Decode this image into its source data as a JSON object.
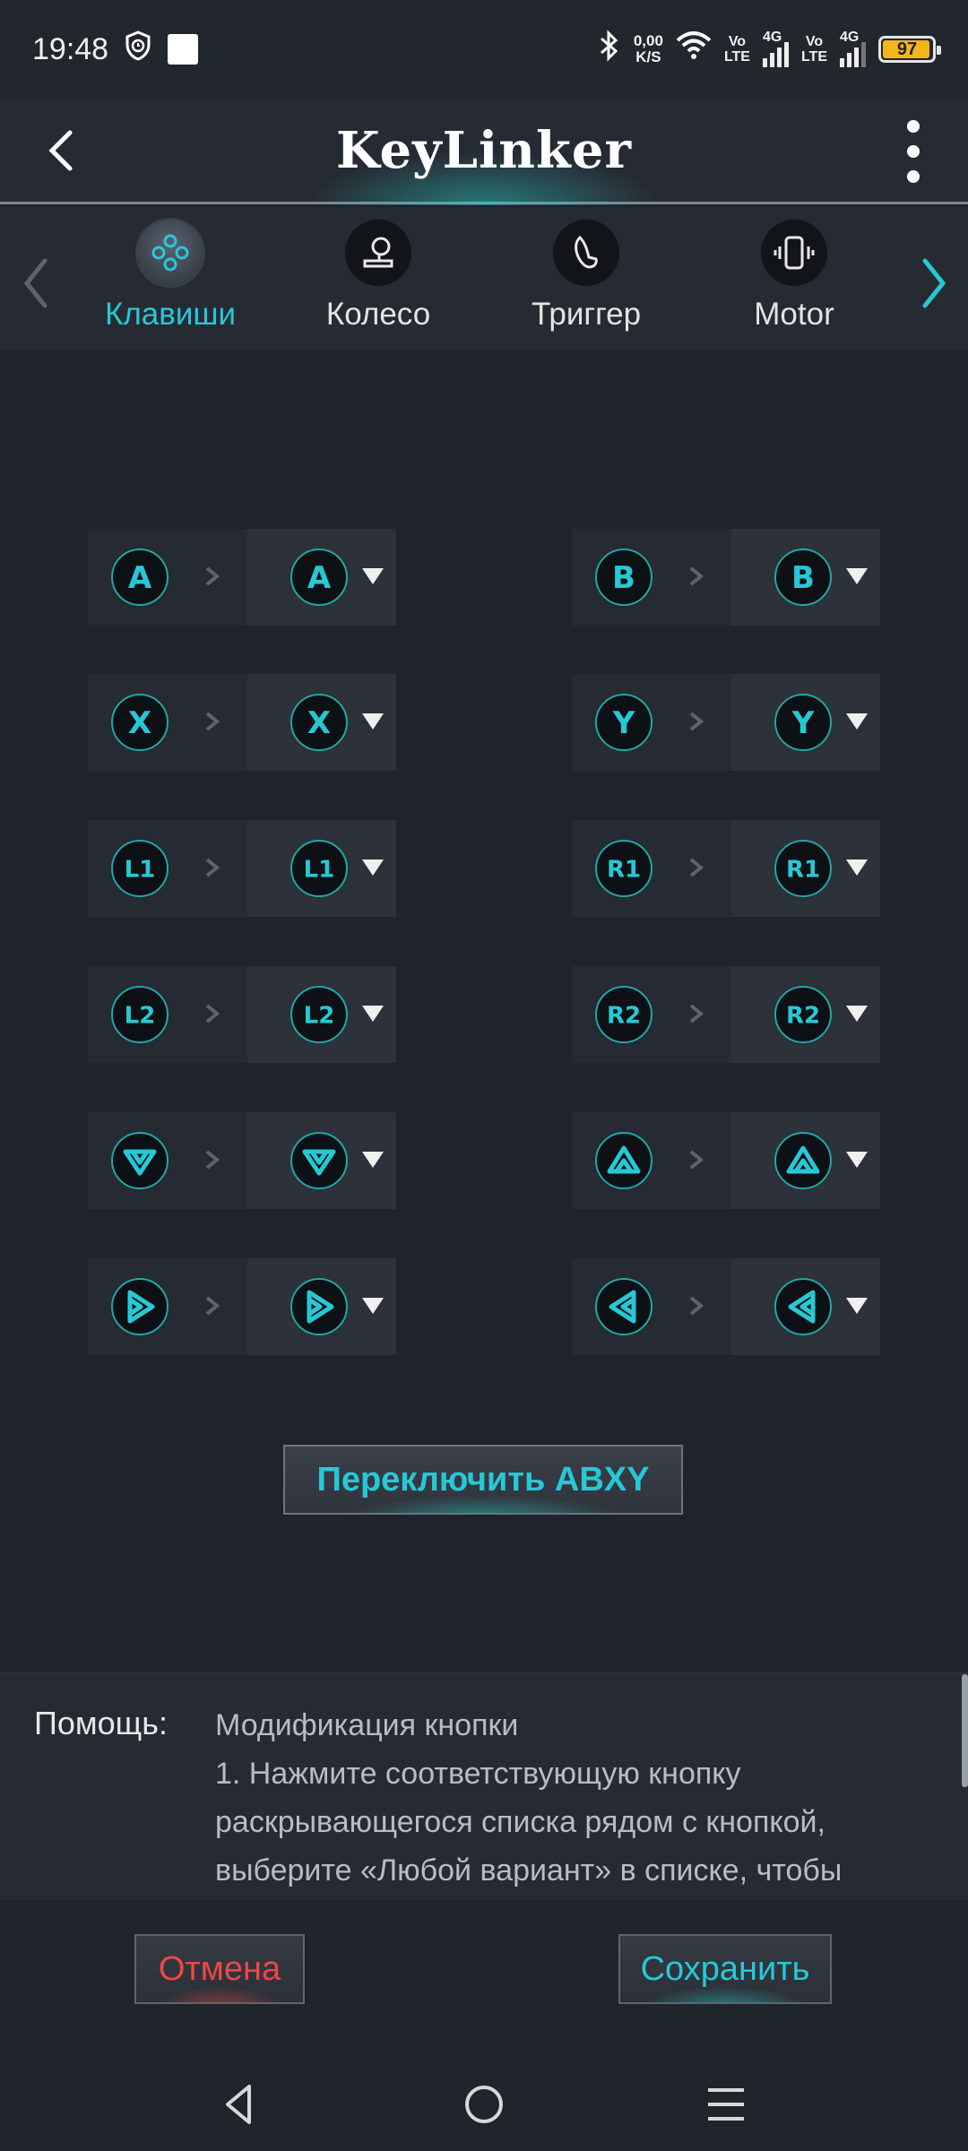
{
  "status_bar": {
    "time": "19:48",
    "net_speed_value": "0,00",
    "net_speed_unit": "K/S",
    "volte1_top": "Vo",
    "volte1_bottom": "LTE",
    "volte2_top": "Vo",
    "volte2_bottom": "LTE",
    "signal1_label": "4G",
    "signal2_label": "4G",
    "battery": "97",
    "icons": [
      "shield-clock-icon",
      "notification-square-icon",
      "bluetooth-icon",
      "wifi-icon",
      "signal-icon",
      "battery-icon"
    ]
  },
  "header": {
    "title": "KeyLinker"
  },
  "tabs": [
    {
      "label": "Клавиши",
      "icon": "gamepad-buttons-icon",
      "active": true
    },
    {
      "label": "Колесо",
      "icon": "joystick-icon",
      "active": false
    },
    {
      "label": "Триггер",
      "icon": "trigger-icon",
      "active": false
    },
    {
      "label": "Motor",
      "icon": "vibration-icon",
      "active": false
    }
  ],
  "mappings": [
    {
      "source": "A",
      "target": "A"
    },
    {
      "source": "B",
      "target": "B"
    },
    {
      "source": "X",
      "target": "X"
    },
    {
      "source": "Y",
      "target": "Y"
    },
    {
      "source": "L1",
      "target": "L1"
    },
    {
      "source": "R1",
      "target": "R1"
    },
    {
      "source": "L2",
      "target": "L2"
    },
    {
      "source": "R2",
      "target": "R2"
    },
    {
      "source": "dpad-down",
      "target": "dpad-down"
    },
    {
      "source": "dpad-up",
      "target": "dpad-up"
    },
    {
      "source": "dpad-right",
      "target": "dpad-right"
    },
    {
      "source": "dpad-left",
      "target": "dpad-left"
    }
  ],
  "switch_button": "Переключить ABXY",
  "help": {
    "label": "Помощь:",
    "line1": "Модификация кнопки",
    "line2": "1. Нажмите соответствующую кнопку",
    "line3": "раскрывающегося списка рядом с кнопкой,",
    "line4": "выберите «Любой вариант» в списке, чтобы"
  },
  "actions": {
    "cancel": "Отмена",
    "save": "Сохранить"
  },
  "colors": {
    "accent": "#27c8d6",
    "cancel": "#ef4747",
    "background": "#1f232b"
  }
}
